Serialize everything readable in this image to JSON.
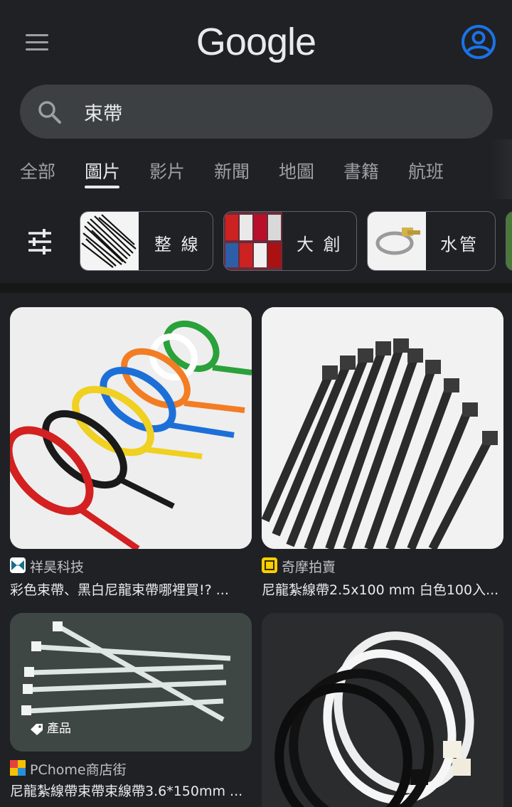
{
  "header": {
    "logo": "Google"
  },
  "search": {
    "query": "束帶"
  },
  "tabs": [
    {
      "label": "全部"
    },
    {
      "label": "圖片"
    },
    {
      "label": "影片"
    },
    {
      "label": "新聞"
    },
    {
      "label": "地圖"
    },
    {
      "label": "書籍"
    },
    {
      "label": "航班"
    }
  ],
  "chips": [
    {
      "label": "整 線"
    },
    {
      "label": "大 創"
    },
    {
      "label": "水管"
    }
  ],
  "results": [
    {
      "source": "祥昊科技",
      "title": "彩色束帶、黑白尼龍束帶哪裡買!? ..."
    },
    {
      "source": "奇摩拍賣",
      "title": "尼龍紮線帶2.5x100 mm 白色100入..."
    },
    {
      "source": "PChome商店街",
      "title": "尼龍紮線帶束帶束線帶3.6*150mm ...",
      "tag": "產品"
    },
    {
      "source": "",
      "title": ""
    }
  ],
  "colors": {
    "background": "#202124",
    "search_bg": "#3c4043",
    "accent_blue": "#1a73e8",
    "muted_text": "#9aa0a6"
  }
}
